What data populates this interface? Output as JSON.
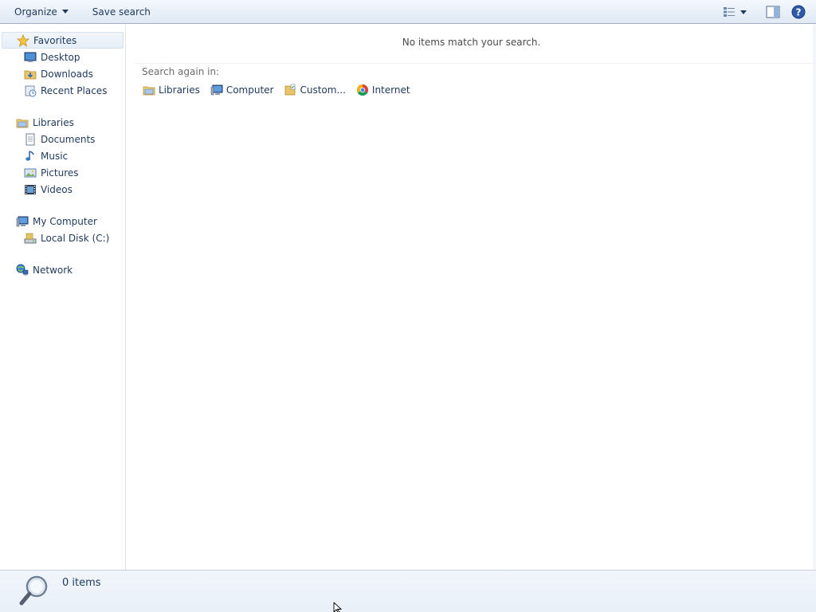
{
  "toolbar": {
    "organize_label": "Organize",
    "save_search_label": "Save search",
    "right_icons": [
      "view-options-icon",
      "preview-pane-icon",
      "help-icon"
    ]
  },
  "nav": {
    "favorites": {
      "label": "Favorites",
      "items": [
        {
          "label": "Desktop",
          "icon": "desktop-icon"
        },
        {
          "label": "Downloads",
          "icon": "downloads-folder-icon"
        },
        {
          "label": "Recent Places",
          "icon": "recent-places-icon"
        }
      ]
    },
    "libraries": {
      "label": "Libraries",
      "items": [
        {
          "label": "Documents",
          "icon": "documents-icon"
        },
        {
          "label": "Music",
          "icon": "music-icon"
        },
        {
          "label": "Pictures",
          "icon": "pictures-icon"
        },
        {
          "label": "Videos",
          "icon": "videos-icon"
        }
      ]
    },
    "computer": {
      "label": "My Computer",
      "items": [
        {
          "label": "Local Disk (C:)",
          "icon": "local-disk-icon"
        }
      ]
    },
    "network": {
      "label": "Network"
    }
  },
  "content": {
    "empty_message": "No items match your search.",
    "search_again_label": "Search again in:",
    "locations": [
      {
        "label": "Libraries",
        "icon": "libraries-icon"
      },
      {
        "label": "Computer",
        "icon": "computer-icon"
      },
      {
        "label": "Custom...",
        "icon": "custom-folder-icon"
      },
      {
        "label": "Internet",
        "icon": "chrome-icon"
      }
    ]
  },
  "details": {
    "item_count": "0 items",
    "icon": "search-magnifier-icon"
  },
  "colors": {
    "text": "#1e395b",
    "toolbar_bg": "#e8eff8",
    "details_bg": "#edf3f9",
    "selection": "#e5edf7"
  }
}
